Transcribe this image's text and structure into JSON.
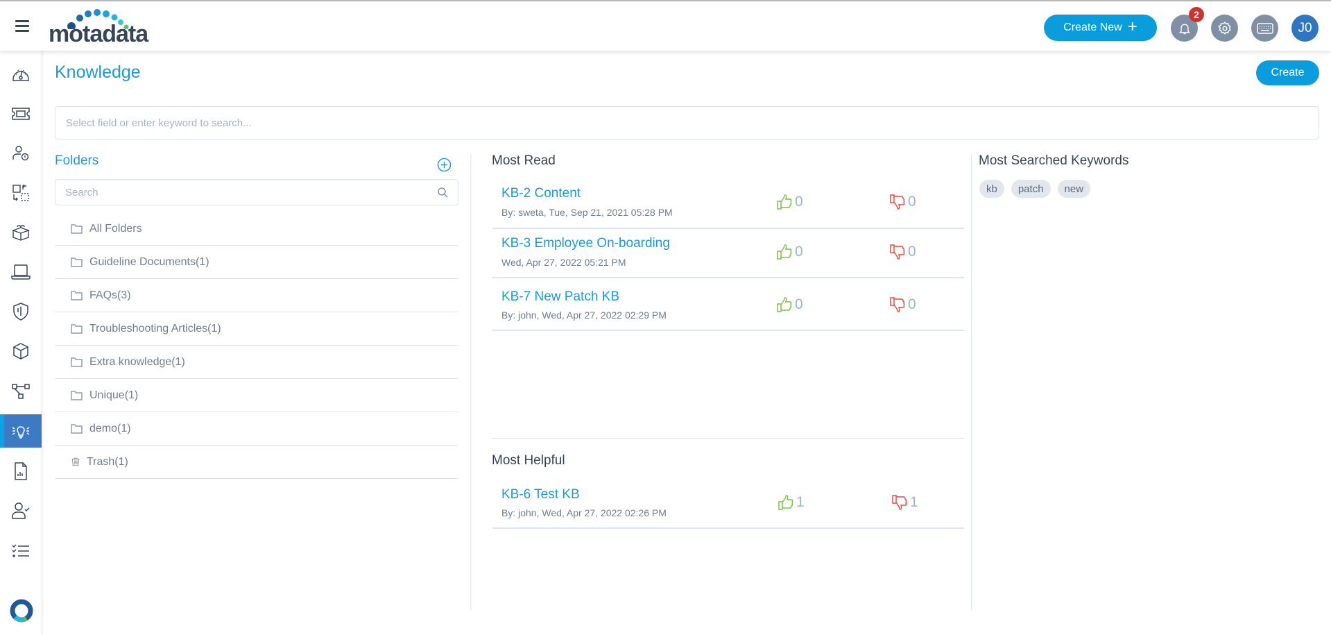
{
  "header": {
    "logo_text": "motadata",
    "create_new_label": "Create New",
    "notification_count": "2",
    "avatar_initials": "J0",
    "icons": [
      "hamburger-menu-icon",
      "bell-icon",
      "gear-icon",
      "keyboard-icon"
    ]
  },
  "sidebar": {
    "items": [
      {
        "name": "dashboard",
        "icon": "speedometer-icon"
      },
      {
        "name": "tickets",
        "icon": "ticket-icon"
      },
      {
        "name": "problems",
        "icon": "user-alert-icon"
      },
      {
        "name": "changes",
        "icon": "change-swap-icon"
      },
      {
        "name": "releases",
        "icon": "package-box-icon"
      },
      {
        "name": "assets",
        "icon": "laptop-icon"
      },
      {
        "name": "security",
        "icon": "shield-icon"
      },
      {
        "name": "cmdb",
        "icon": "cube-icon"
      },
      {
        "name": "workflow",
        "icon": "flow-nodes-icon"
      },
      {
        "name": "knowledge",
        "icon": "lightbulb-icon",
        "active": true
      },
      {
        "name": "reports",
        "icon": "report-chart-icon"
      },
      {
        "name": "approvals",
        "icon": "user-check-icon"
      },
      {
        "name": "tasks",
        "icon": "checklist-icon"
      }
    ],
    "accent": "#3c7bc4"
  },
  "page": {
    "title": "Knowledge",
    "create_label": "Create",
    "search_placeholder": "Select field or enter keyword to search..."
  },
  "folders": {
    "title": "Folders",
    "search_placeholder": "Search",
    "items": [
      {
        "label": "All Folders",
        "icon": "folder-icon"
      },
      {
        "label": "Guideline Documents(1)",
        "icon": "folder-icon"
      },
      {
        "label": "FAQs(3)",
        "icon": "folder-icon"
      },
      {
        "label": "Troubleshooting Articles(1)",
        "icon": "folder-icon"
      },
      {
        "label": "Extra knowledge(1)",
        "icon": "folder-icon"
      },
      {
        "label": "Unique(1)",
        "icon": "folder-icon"
      },
      {
        "label": "demo(1)",
        "icon": "folder-icon"
      },
      {
        "label": "Trash(1)",
        "icon": "trash-icon"
      }
    ]
  },
  "most_read": {
    "title": "Most Read",
    "items": [
      {
        "title": "KB-2 Content",
        "meta": "By: sweta, Tue, Sep 21, 2021 05:28 PM",
        "likes": "0",
        "dislikes": "0"
      },
      {
        "title": "KB-3 Employee On-boarding",
        "meta": "Wed, Apr 27, 2022 05:21 PM",
        "likes": "0",
        "dislikes": "0"
      },
      {
        "title": "KB-7 New Patch KB",
        "meta": "By: john, Wed, Apr 27, 2022 02:29 PM",
        "likes": "0",
        "dislikes": "0"
      }
    ]
  },
  "most_helpful": {
    "title": "Most Helpful",
    "items": [
      {
        "title": "KB-6 Test KB",
        "meta": "By: john, Wed, Apr 27, 2022 02:26 PM",
        "likes": "1",
        "dislikes": "1"
      }
    ]
  },
  "keywords": {
    "title": "Most Searched Keywords",
    "items": [
      "kb",
      "patch",
      "new"
    ]
  },
  "colors": {
    "brand_blue": "#099ddd",
    "title_blue": "#1a9bd7",
    "like_green": "#7cc242",
    "dislike_red": "#e8493f",
    "badge_red": "#d0312d"
  }
}
